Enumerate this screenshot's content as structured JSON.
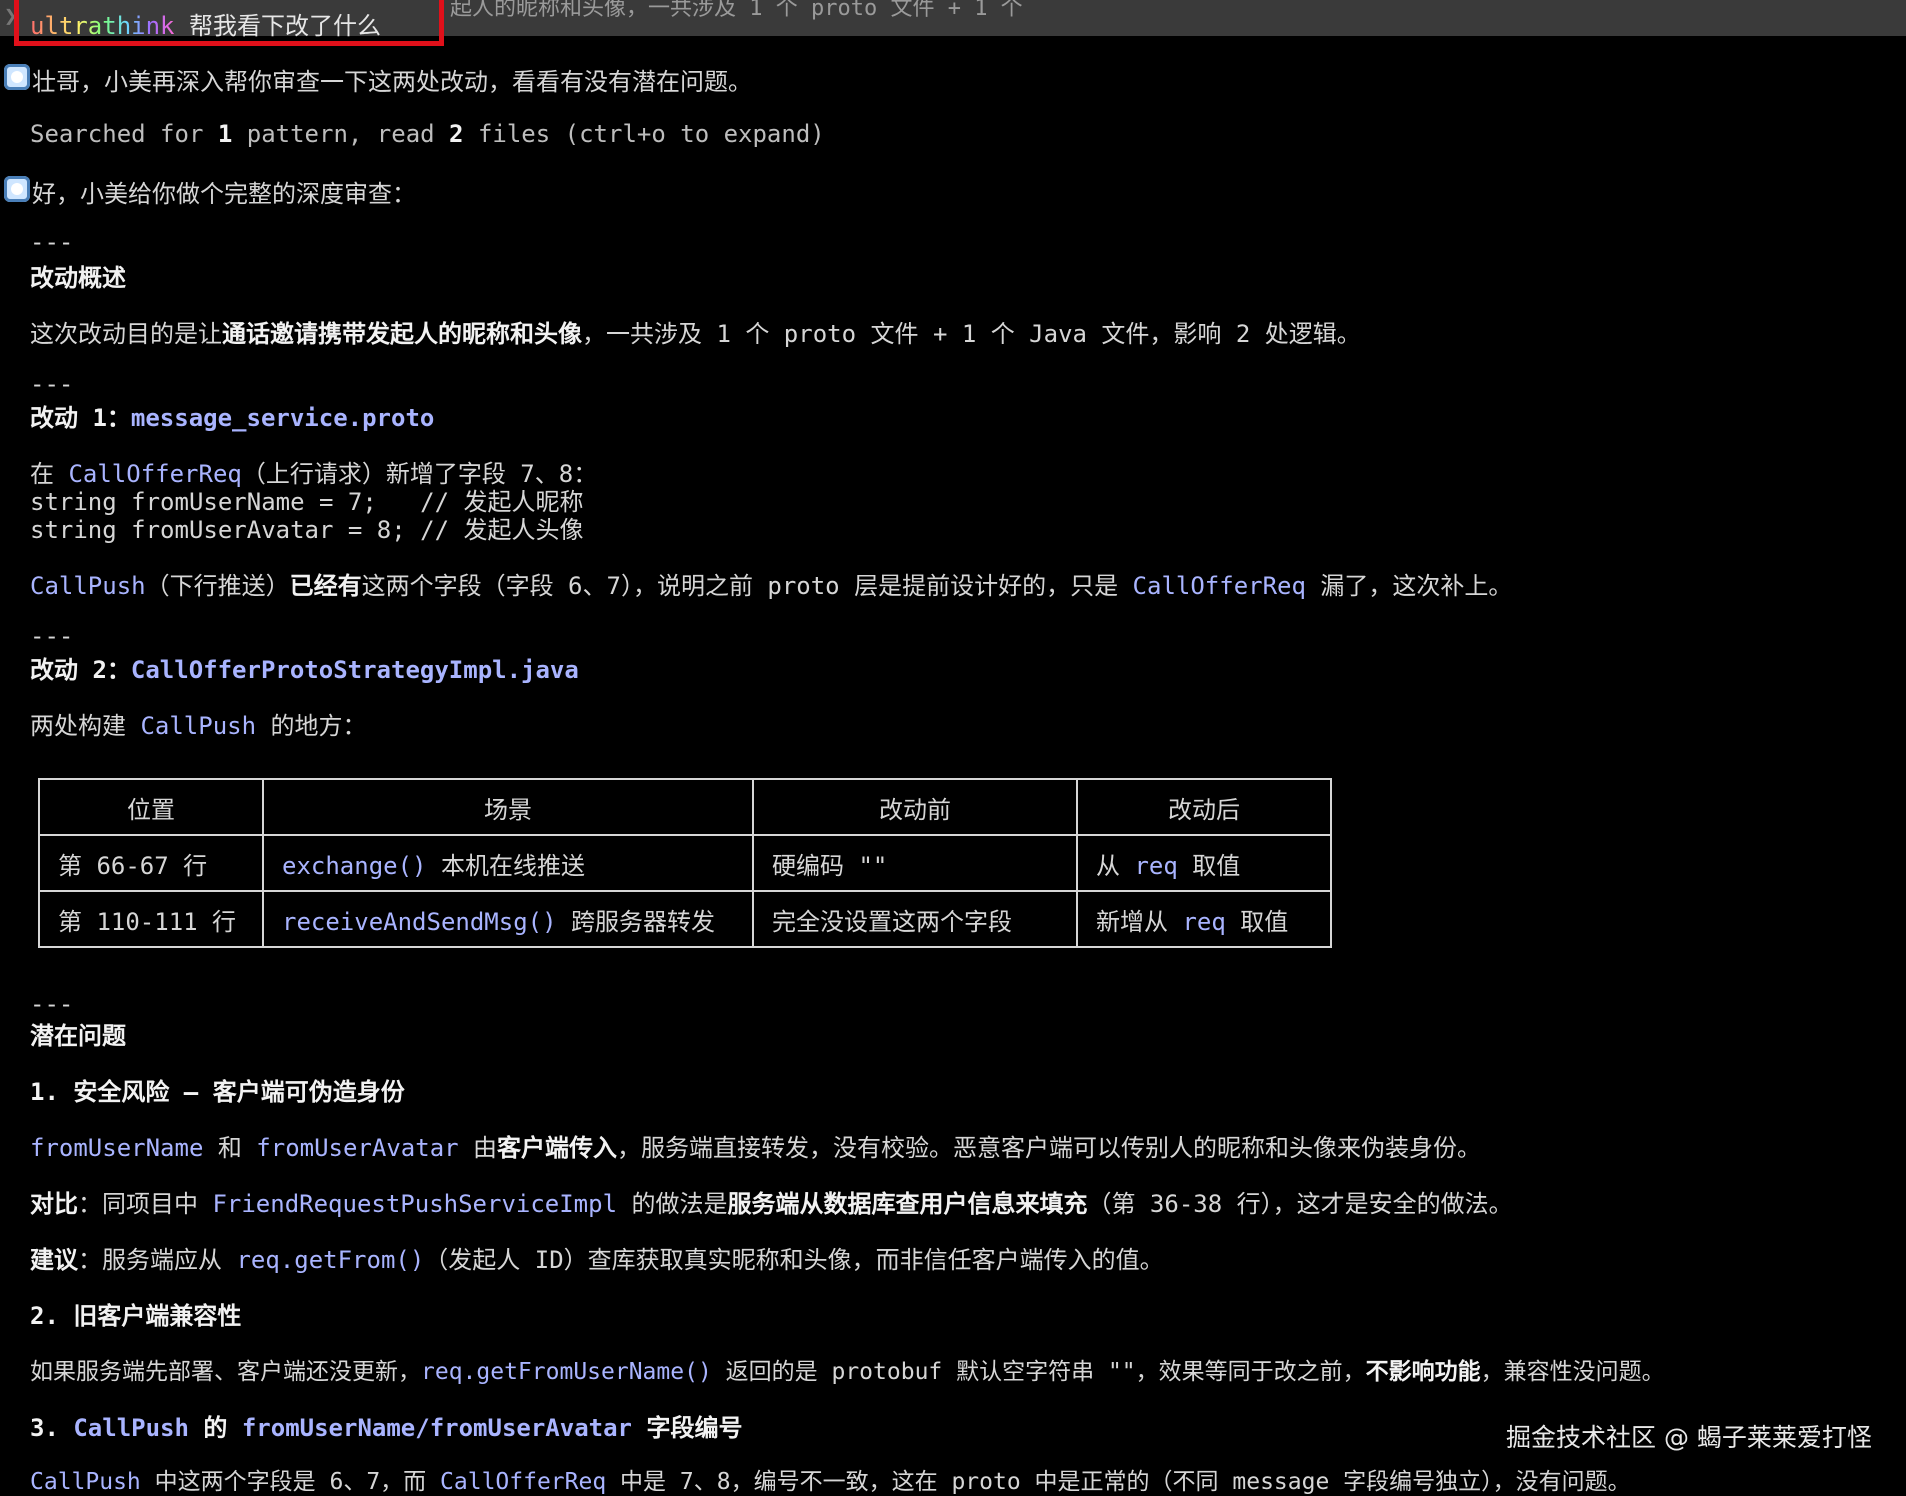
{
  "prompt": {
    "keyword": "ultrathink",
    "text": " 帮我看下改了什么",
    "trailing": "起人的昵称和头像，一共涉及 1 个 proto 文件 + 1 个"
  },
  "messages": {
    "intro": "壮哥，小美再深入帮你审查一下这两处改动，看看有没有潜在问题。",
    "searched_a": "Searched for ",
    "searched_n1": "1",
    "searched_b": " pattern, read ",
    "searched_n2": "2",
    "searched_c": " files (ctrl+o to expand)",
    "review_intro": "好，小美给你做个完整的深度审查："
  },
  "overview": {
    "divider": "---",
    "heading": "改动概述",
    "p_a": "这次改动目的是让",
    "p_bold": "通话邀请携带发起人的昵称和头像",
    "p_b": "，一共涉及 1 个 proto 文件 + 1 个 Java 文件，影响 2 处逻辑。"
  },
  "change1": {
    "divider": "---",
    "heading_prefix": "改动 1：",
    "heading_file": "message_service.proto",
    "line1_a": "在 ",
    "line1_code": "CallOfferReq",
    "line1_b": "（上行请求）新增了字段 7、8：",
    "code_line1": "string fromUserName = 7;   // 发起人昵称",
    "code_line2": "string fromUserAvatar = 8; // 发起人头像",
    "p2_code1": "CallPush",
    "p2_a": "（下行推送）",
    "p2_bold": "已经有",
    "p2_b": "这两个字段（字段 6、7），说明之前 proto 层是提前设计好的，只是 ",
    "p2_code2": "CallOfferReq",
    "p2_c": " 漏了，这次补上。"
  },
  "change2": {
    "divider": "---",
    "heading_prefix": "改动 2：",
    "heading_file": "CallOfferProtoStrategyImpl.java",
    "p_a": "两处构建 ",
    "p_code": "CallPush",
    "p_b": " 的地方："
  },
  "table": {
    "headers": [
      "位置",
      "场景",
      "改动前",
      "改动后"
    ],
    "rows": [
      {
        "pos": "第 66-67 行",
        "scene_code": "exchange()",
        "scene_text": " 本机在线推送",
        "before": "硬编码 \"\"",
        "after_a": "从 ",
        "after_code": "req",
        "after_b": " 取值"
      },
      {
        "pos": "第 110-111 行",
        "scene_code": "receiveAndSendMsg()",
        "scene_text": " 跨服务器转发",
        "before": "完全没设置这两个字段",
        "after_a": "新增从 ",
        "after_code": "req",
        "after_b": " 取值"
      }
    ]
  },
  "issues": {
    "divider": "---",
    "heading": "潜在问题",
    "i1_heading": "1. 安全风险 — 客户端可伪造身份",
    "i1_code1": "fromUserName",
    "i1_a": " 和 ",
    "i1_code2": "fromUserAvatar",
    "i1_b": " 由",
    "i1_bold": "客户端传入",
    "i1_c": "，服务端直接转发，没有校验。恶意客户端可以传别人的昵称和头像来伪装身份。",
    "cmp_bold": "对比",
    "cmp_a": "：同项目中 ",
    "cmp_code": "FriendRequestPushServiceImpl",
    "cmp_b": " 的做法是",
    "cmp_bold2": "服务端从数据库查用户信息来填充",
    "cmp_c": "（第 36-38 行），这才是安全的做法。",
    "sug_bold": "建议",
    "sug_a": "：服务端应从 ",
    "sug_code": "req.getFrom()",
    "sug_b": "（发起人 ID）查库获取真实昵称和头像，而非信任客户端传入的值。",
    "i2_heading": "2. 旧客户端兼容性",
    "i2_a": "如果服务端先部署、客户端还没更新，",
    "i2_code": "req.getFromUserName()",
    "i2_b": " 返回的是 protobuf 默认空字符串 \"\"，效果等同于改之前，",
    "i2_bold": "不影响功能",
    "i2_c": "，兼容性没问题。",
    "i3_a": "3. ",
    "i3_code1": "CallPush",
    "i3_b": " 的 ",
    "i3_code2": "fromUserName/fromUserAvatar",
    "i3_c": " 字段编号",
    "i3p_code1": "CallPush",
    "i3p_a": " 中这两个字段是 6、7，而 ",
    "i3p_code2": "CallOfferReq",
    "i3p_b": " 中是 7、8，编号不一致，这在 proto 中是正常的（不同 message 字段编号独立），没有问题。"
  },
  "watermark": "掘金技术社区 @ 蝎子莱莱爱打怪"
}
